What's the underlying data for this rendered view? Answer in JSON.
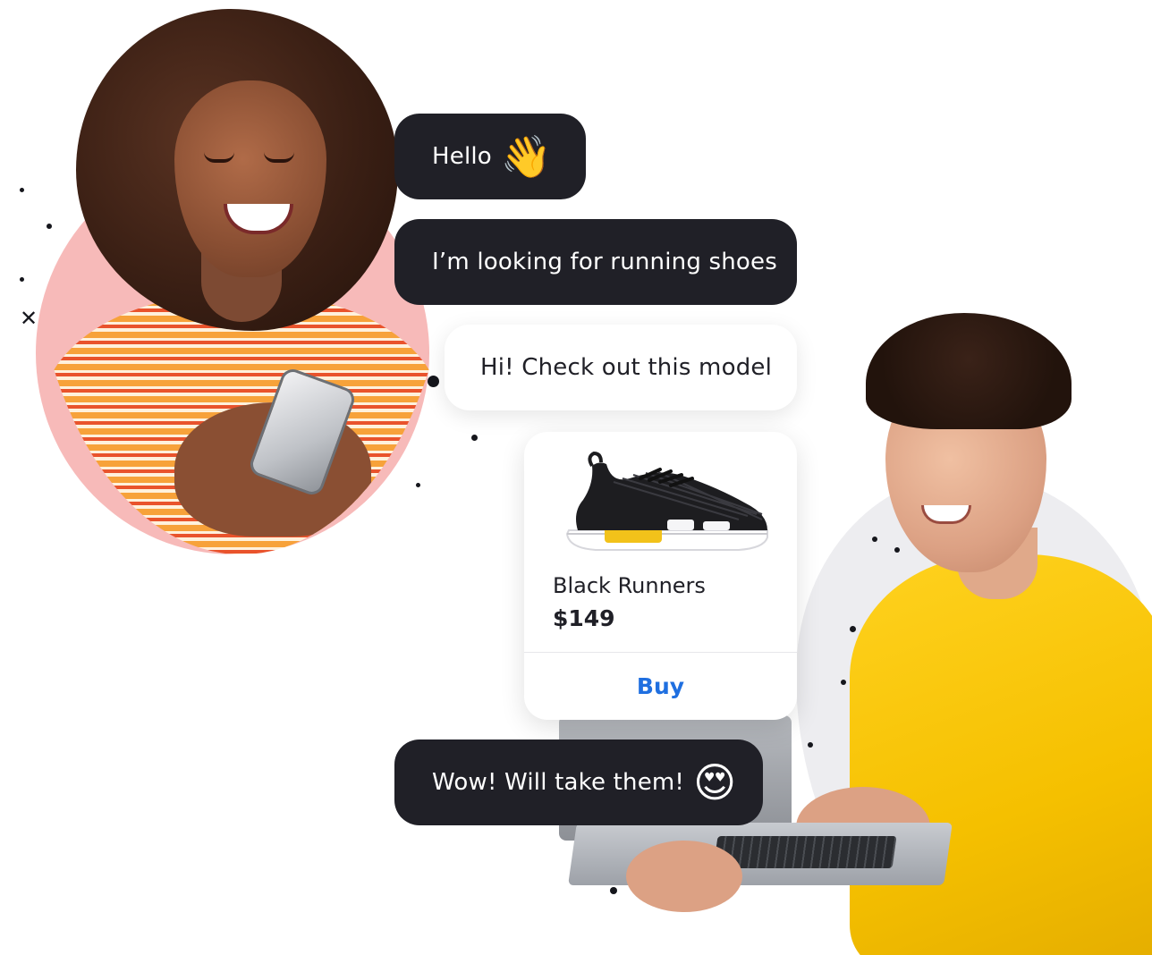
{
  "chat": {
    "messages": [
      {
        "sender": "customer",
        "text": "Hello",
        "emoji": "👋"
      },
      {
        "sender": "customer",
        "text": "I’m looking for running shoes"
      },
      {
        "sender": "agent",
        "text": "Hi! Check out this model"
      },
      {
        "sender": "customer",
        "text": "Wow! Will take them!",
        "emoji": "😍"
      }
    ],
    "product_card": {
      "name": "Black Runners",
      "price": "$149",
      "button_label": "Buy",
      "image_icon": "sneaker-icon"
    }
  },
  "colors": {
    "dark_bubble": "#202027",
    "light_bubble": "#ffffff",
    "buy_button_text": "#1f6fe0",
    "woman_blob": "#f4a3a1",
    "man_blob": "#ededf0",
    "man_shirt": "#f5c000"
  }
}
